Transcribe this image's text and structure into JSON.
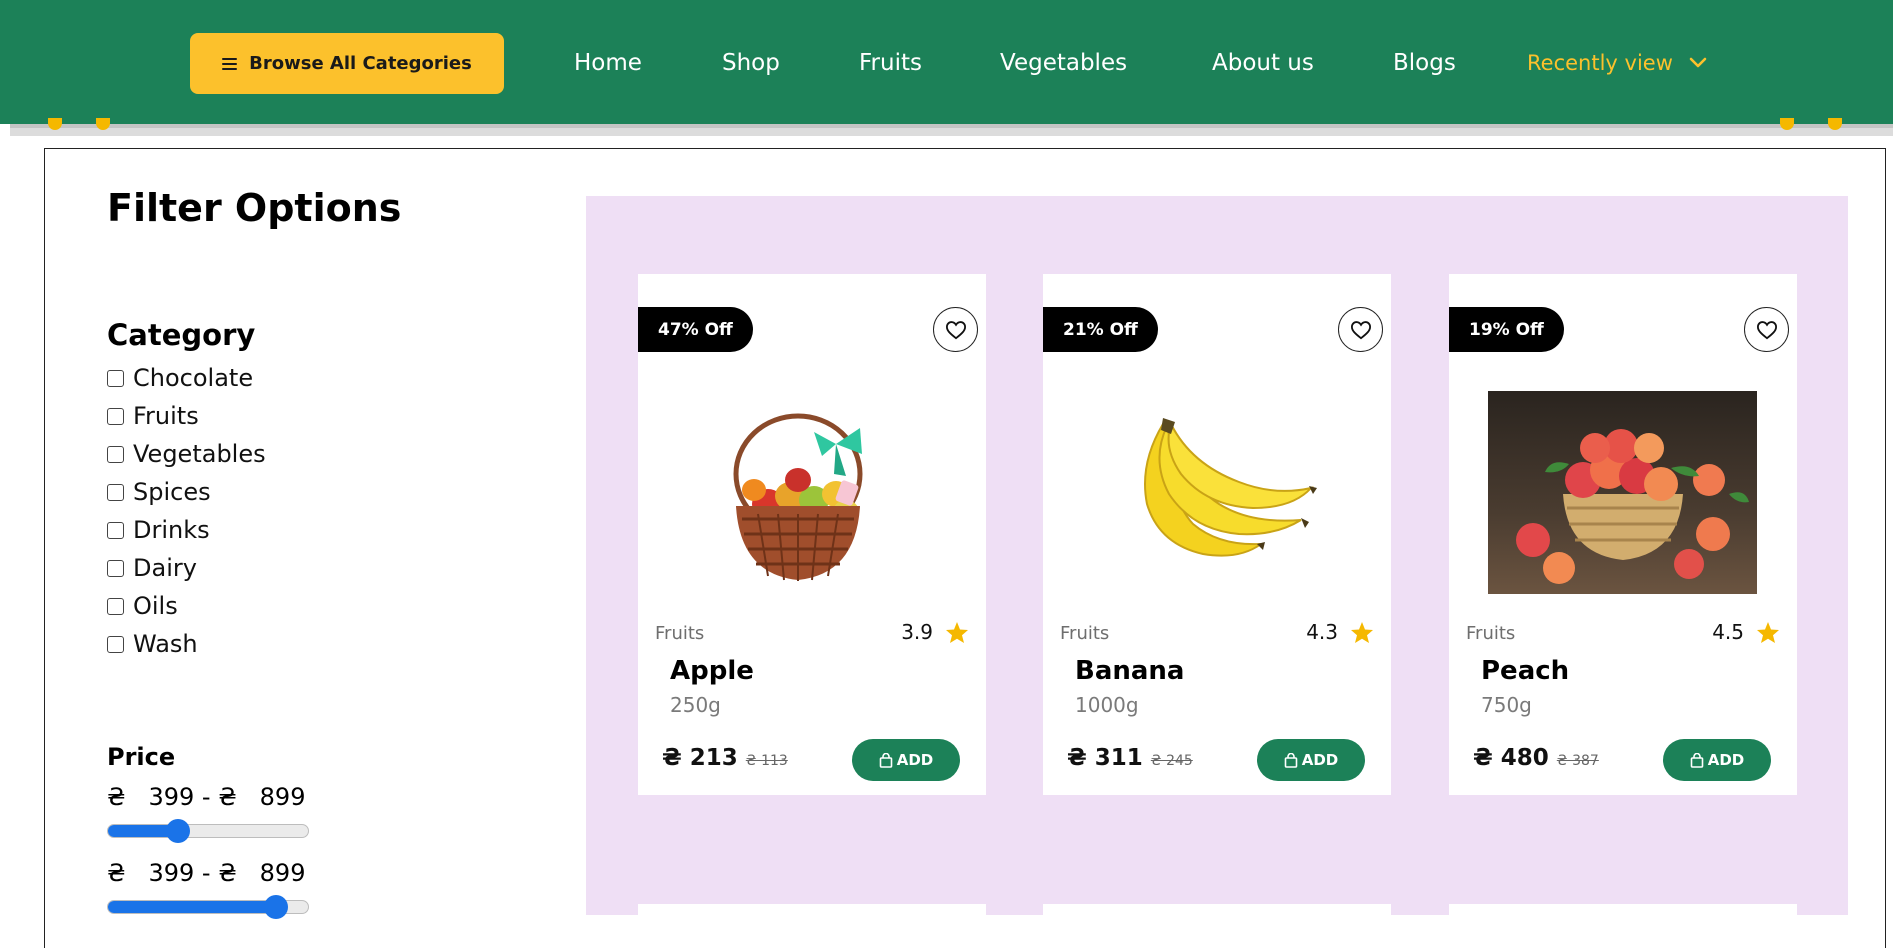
{
  "header": {
    "browse_label": "Browse All Categories",
    "nav": [
      "Home",
      "Shop",
      "Fruits",
      "Vegetables",
      "About us",
      "Blogs"
    ],
    "recent_label": "Recently view"
  },
  "filters": {
    "title": "Filter Options",
    "category_title": "Category",
    "categories": [
      "Chocolate",
      "Fruits",
      "Vegetables",
      "Spices",
      "Drinks",
      "Dairy",
      "Oils",
      "Wash"
    ],
    "price_title": "Price",
    "price_range_1": "₴   399 - ₴   899",
    "price_range_2": "₴   399 - ₴   899",
    "slider_1_level": 0.35,
    "slider_2_level": 0.84
  },
  "products": [
    {
      "discount": "47% Off",
      "category": "Fruits",
      "rating": "3.9",
      "name": "Apple",
      "weight": "250g",
      "price": "₴ 213",
      "old_price": "₴ 113",
      "add_label": "ADD",
      "image": "fruit-basket"
    },
    {
      "discount": "21% Off",
      "category": "Fruits",
      "rating": "4.3",
      "name": "Banana",
      "weight": "1000g",
      "price": "₴ 311",
      "old_price": "₴ 245",
      "add_label": "ADD",
      "image": "banana-bunch"
    },
    {
      "discount": "19% Off",
      "category": "Fruits",
      "rating": "4.5",
      "name": "Peach",
      "weight": "750g",
      "price": "₴ 480",
      "old_price": "₴ 387",
      "add_label": "ADD",
      "image": "peach-basket"
    }
  ],
  "colors": {
    "header_green": "#1c8158",
    "accent_yellow": "#fcc12c",
    "panel_lilac": "#efdff5",
    "star_yellow": "#f5b800",
    "slider_blue": "#1a73e8"
  },
  "icons": {
    "menu": "menu-icon",
    "chevron": "chevron-down-icon",
    "heart": "heart-icon",
    "star": "star-icon",
    "bag": "shopping-bag-icon"
  }
}
